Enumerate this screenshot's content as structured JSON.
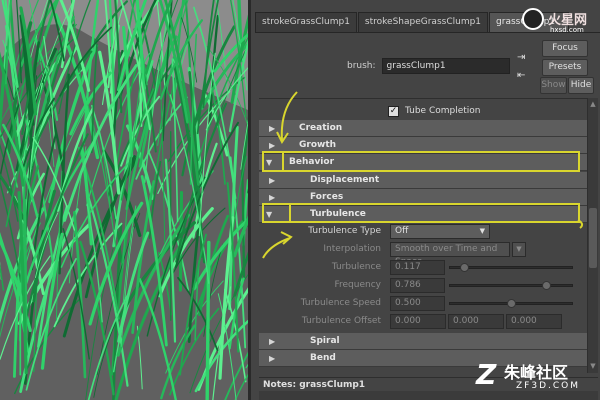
{
  "tabs": [
    {
      "label": "strokeGrassClump1",
      "active": false
    },
    {
      "label": "strokeShapeGrassClump1",
      "active": false
    },
    {
      "label": "grassClump1",
      "active": true
    }
  ],
  "brush": {
    "label": "brush:",
    "value": "grassClump1"
  },
  "side_buttons": {
    "focus": "Focus",
    "presets": "Presets",
    "show": "Show",
    "hide": "Hide"
  },
  "tube_completion": {
    "label": "Tube Completion",
    "checked": true
  },
  "sections": {
    "creation": "Creation",
    "growth": "Growth",
    "behavior": "Behavior",
    "displacement": "Displacement",
    "forces": "Forces",
    "turbulence": "Turbulence",
    "spiral": "Spiral",
    "bend": "Bend"
  },
  "turbulence_attrs": {
    "type_label": "Turbulence Type",
    "type_value": "Off",
    "interp_label": "Interpolation",
    "interp_value": "Smooth over Time and Space",
    "turbulence_label": "Turbulence",
    "turbulence_value": "0.117",
    "turbulence_fraction": 0.117,
    "frequency_label": "Frequency",
    "frequency_value": "0.786",
    "frequency_fraction": 0.786,
    "speed_label": "Turbulence Speed",
    "speed_value": "0.500",
    "speed_fraction": 0.5,
    "offset_label": "Turbulence Offset",
    "offset_values": [
      "0.000",
      "0.000",
      "0.000"
    ]
  },
  "notes": {
    "label": "Notes:  grassClump1"
  },
  "watermarks": {
    "top_right_brand": "火星网",
    "top_right_site": "hxsd.com",
    "bottom_right_brand": "朱峰社区",
    "bottom_right_site": "ZF3D.COM"
  },
  "colors": {
    "annotation": "#d9d62e",
    "grass": "#2fd36a",
    "panel_bg": "#444444",
    "frame_bg": "#5d5d5d"
  }
}
